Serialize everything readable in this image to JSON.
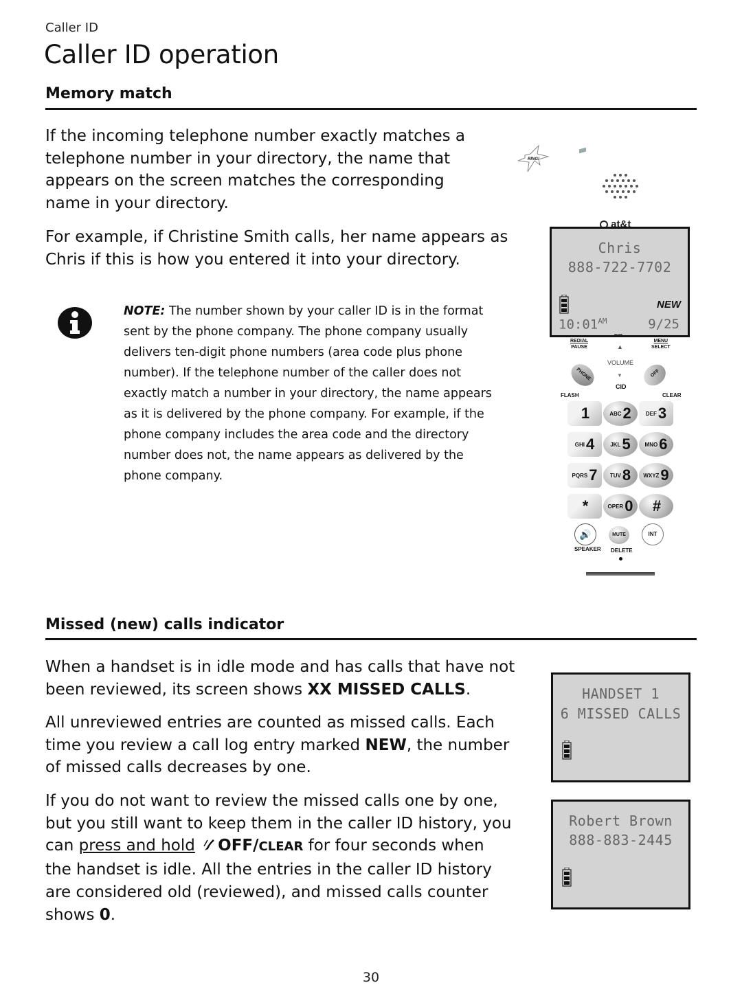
{
  "header": {
    "breadcrumb": "Caller ID",
    "title": "Caller ID operation"
  },
  "memory_match": {
    "heading": "Memory match",
    "para1": [
      "If the incoming telephone number exactly matches a",
      "telephone number in your directory, the name that",
      "appears on the screen matches the corresponding",
      "name in your directory."
    ],
    "para2": [
      "For example, if Christine Smith calls, her name appears as",
      "Chris if this is how you entered it into your directory."
    ],
    "note_label": "NOTE:",
    "note_lines": [
      " The number shown by your caller ID is in the format",
      "sent by the phone company. The phone company usually",
      "delivers ten-digit phone numbers (area code plus phone",
      "number). If the telephone number of the caller does not",
      "exactly match a number in your directory, the name appears",
      "as it is delivered by the phone company. For example, if the",
      "phone company includes the area code and the directory",
      "number does not, the name appears as delivered by the",
      "phone company."
    ],
    "info_icon": "info-icon"
  },
  "handset_illustration": {
    "ring_label": "RING!",
    "brand": "at&t",
    "screen": {
      "name": "Chris",
      "number": "888-722-7702",
      "new_label": "NEW",
      "time": "10:01",
      "ampm": "AM",
      "date": "9/25"
    },
    "keys": {
      "redial": "REDIAL",
      "pause": "PAUSE",
      "dir": "DIR",
      "menu": "MENU",
      "select": "SELECT",
      "volume": "VOLUME",
      "phone": "PHONE",
      "off": "OFF",
      "cid": "CID",
      "flash": "FLASH",
      "clear": "CLEAR",
      "digits": [
        {
          "letters": "",
          "digit": "1"
        },
        {
          "letters": "ABC",
          "digit": "2"
        },
        {
          "letters": "DEF",
          "digit": "3"
        },
        {
          "letters": "GHI",
          "digit": "4"
        },
        {
          "letters": "JKL",
          "digit": "5"
        },
        {
          "letters": "MNO",
          "digit": "6"
        },
        {
          "letters": "PQRS",
          "digit": "7"
        },
        {
          "letters": "TUV",
          "digit": "8"
        },
        {
          "letters": "WXYZ",
          "digit": "9"
        },
        {
          "letters": "",
          "digit": "*"
        },
        {
          "letters": "OPER",
          "digit": "0"
        },
        {
          "letters": "",
          "digit": "#"
        }
      ],
      "speaker": "SPEAKER",
      "mute": "MUTE",
      "delete": "DELETE",
      "int": "INT"
    }
  },
  "missed_calls": {
    "heading": "Missed (new) calls indicator",
    "p1_pre": "When a handset is in idle mode and has calls that have not",
    "p1_line2_pre": "been reviewed, its screen shows ",
    "p1_bold": "XX MISSED CALLS",
    "p1_post": ".",
    "p2_line1": "All unreviewed entries are counted as missed calls. Each",
    "p2_line2_pre": "time you review a call log entry marked ",
    "p2_bold": "NEW",
    "p2_line2_post": ", the number",
    "p2_line3": "of missed calls decreases by one.",
    "p3_line1": "If you do not want to review the missed calls one by one,",
    "p3_line2": "but you still want to keep them in the caller ID history, you",
    "p3_line3_pre": "can ",
    "p3_link": "press and hold",
    "p3_key_off": "OFF/",
    "p3_key_clear": "CLEAR",
    "p3_line3_post": " for four seconds when",
    "p3_line4": "the handset is idle. All the entries in the caller ID history",
    "p3_line5": "are considered old (reviewed), and missed calls counter",
    "p3_line6_pre": "shows ",
    "p3_bold_zero": "0",
    "p3_line6_post": ".",
    "screen1": {
      "line1": "HANDSET 1",
      "line2": "6 MISSED CALLS"
    },
    "screen2": {
      "line1": "Robert Brown",
      "line2": "888-883-2445"
    }
  },
  "footer": {
    "page_number": "30"
  }
}
